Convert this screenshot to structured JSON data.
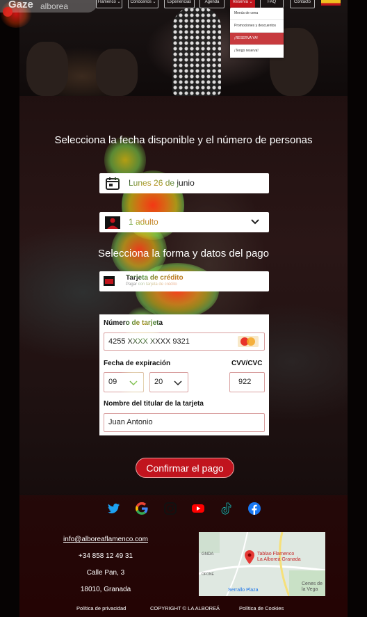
{
  "brand": {
    "logo_text": "Gaze",
    "logo_sub": "alborea"
  },
  "nav": {
    "items": [
      {
        "label": "Flamenco ⌄"
      },
      {
        "label": "Conócenos ⌄"
      },
      {
        "label": "Experiencias"
      },
      {
        "label": "Agenda"
      },
      {
        "label": "Reserva ⌄"
      },
      {
        "label": "FAQ"
      },
      {
        "label": "Contacto"
      }
    ],
    "language_flag": "ES"
  },
  "reserva_menu": {
    "items": [
      {
        "label": "Menús de cena"
      },
      {
        "label": "Promociones y descuentos"
      },
      {
        "label": "¡RESERVA YA!"
      },
      {
        "label": "¡Tengo reserva!"
      }
    ]
  },
  "booking": {
    "title": "Selecciona la fecha disponible y el número de personas",
    "date_value": "Lunes 26 de junio",
    "people_value": "1 adulto"
  },
  "payment": {
    "title": "Selecciona la forma y datos del pago",
    "method_label": "Tarjeta de crédito",
    "method_sub": "Pagar con tarjeta de crédito",
    "card_number_label": "Número de tarjeta",
    "card_number_value": "4255 XXXX XXXX 9321",
    "card_brand": "MasterCard",
    "expiry_label": "Fecha de expiración",
    "expiry_month": "09",
    "expiry_year": "20",
    "cvv_label": "CVV/CVC",
    "cvv_value": "922",
    "holder_label": "Nombre del titular de la tarjeta",
    "holder_value": "Juan Antonio",
    "confirm_label": "Confirmar el pago"
  },
  "footer": {
    "social": [
      "twitter-icon",
      "google-icon",
      "instagram-icon",
      "youtube-icon",
      "tiktok-icon",
      "facebook-icon"
    ],
    "email": "info@alboreaflamenco.com",
    "phone": "+34 858 12 49 31",
    "address1": "Calle Pan, 3",
    "address2": "18010, Granada",
    "map": {
      "title1": "Tablao Flamenco",
      "title2": "La Alboreá Granada",
      "place1": "Serrallo Plaza",
      "place2": "Cenes de la Vega",
      "label1": "GNDA",
      "label2": "OFONE"
    },
    "links": {
      "privacy": "Política de privacidad",
      "copyright": "COPYRIGHT © LA ALBOREÁ",
      "cookies": "Política de Cookies"
    }
  },
  "colors": {
    "accent": "#c1141e",
    "heat_hot": "#ff2a00",
    "heat_warm": "#ffe600",
    "heat_cool": "#7dff4a"
  }
}
